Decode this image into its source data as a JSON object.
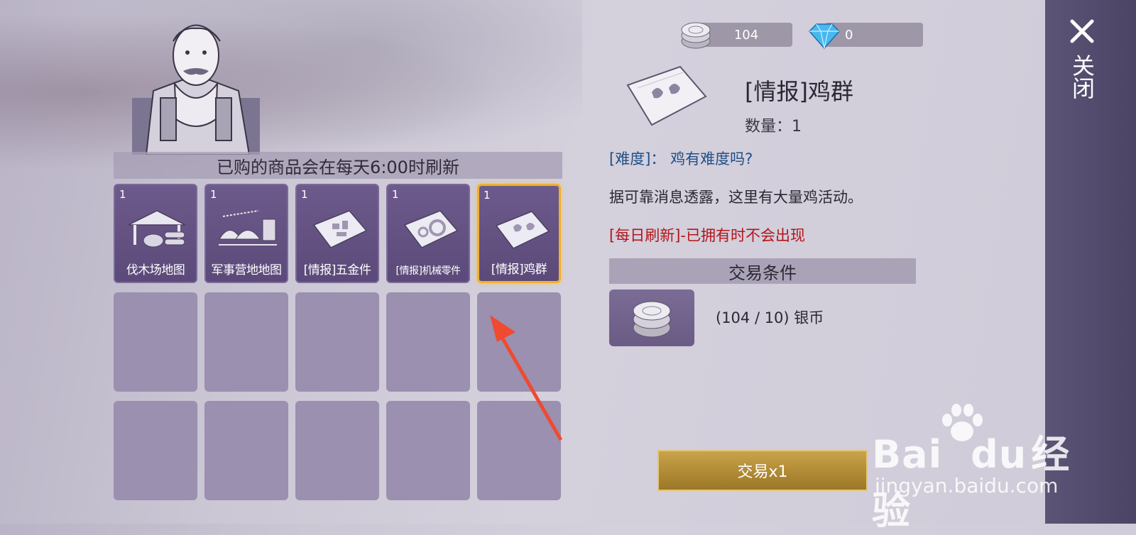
{
  "currencies": {
    "silver": "104",
    "diamond": "0"
  },
  "notice": "已购的商品会在每天6:00时刷新",
  "shop_items": [
    {
      "qty": "1",
      "name": "伐木场地图",
      "icon": "lumber-mill-map-icon"
    },
    {
      "qty": "1",
      "name": "军事营地地图",
      "icon": "military-camp-map-icon"
    },
    {
      "qty": "1",
      "name": "[情报]五金件",
      "icon": "intel-hardware-icon"
    },
    {
      "qty": "1",
      "name": "[情报]机械零件",
      "icon": "intel-machine-parts-icon"
    },
    {
      "qty": "1",
      "name": "[情报]鸡群",
      "icon": "intel-chickens-icon"
    }
  ],
  "detail": {
    "title": "[情报]鸡群",
    "count": "数量：1",
    "difficulty_label": "[难度]",
    "difficulty_sep": "：",
    "difficulty_value": "鸡有难度吗?",
    "description": "据可靠消息透露，这里有大量鸡活动。",
    "refresh_note": "[每日刷新]-已拥有时不会出现",
    "trade_header": "交易条件",
    "cost": "(104 / 10) 银币",
    "trade_button": "交易x1"
  },
  "close_label": "关闭",
  "watermark": {
    "brand_a": "Bai",
    "brand_b": "du",
    "brand_c": "经验",
    "url": "jingyan.baidu.com"
  },
  "colors": {
    "selected_border": "#f0b030",
    "refresh_red": "#b3151a",
    "difficulty_blue": "#1e4f86",
    "annotation_arrow": "#f04a30"
  }
}
